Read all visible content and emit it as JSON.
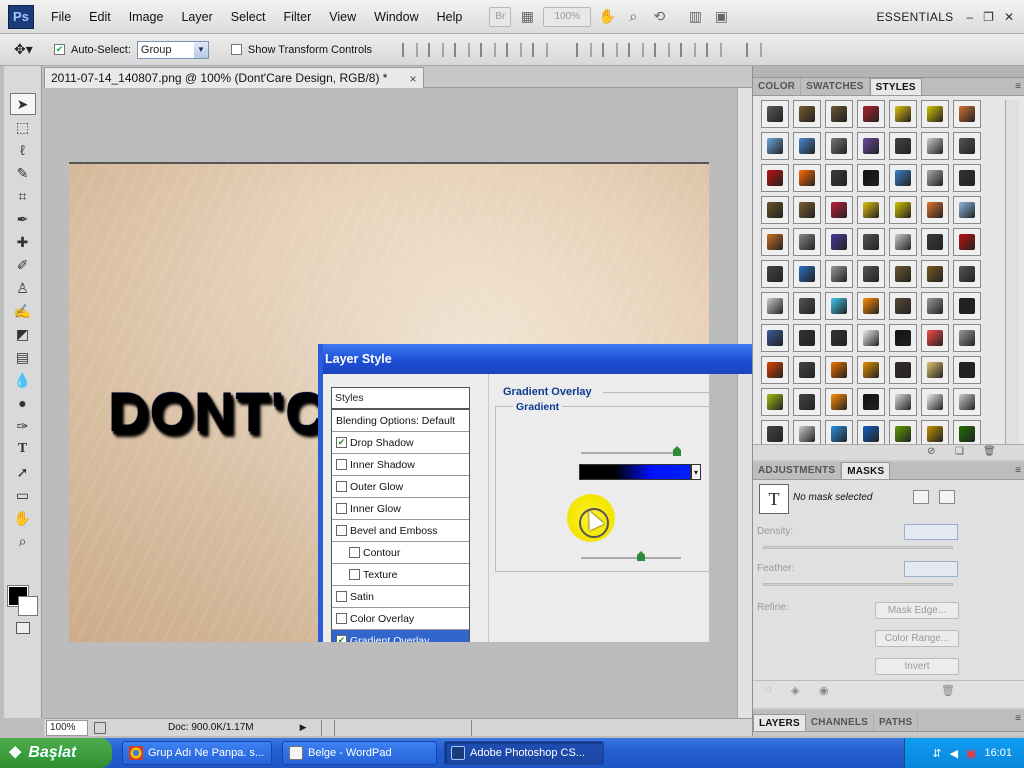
{
  "app": {
    "logo": "Ps",
    "workspace": "ESSENTIALS",
    "zoom_display": "100%"
  },
  "menu": [
    "File",
    "Edit",
    "Image",
    "Layer",
    "Select",
    "Filter",
    "View",
    "Window",
    "Help"
  ],
  "options_bar": {
    "auto_select_label": "Auto-Select:",
    "auto_select_checked": true,
    "group_value": "Group",
    "transform_label": "Show Transform Controls"
  },
  "document": {
    "tab_title": "2011-07-14_140807.png @ 100% (Dont'Care Design, RGB/8) *",
    "close_glyph": "×",
    "canvas_text": "DONT'C",
    "status_zoom": "100%",
    "status_info": "Doc: 900.0K/1.17M"
  },
  "dialog": {
    "title": "Layer Style",
    "styles_header": "Styles",
    "blending": "Blending Options: Default",
    "items": [
      {
        "label": "Drop Shadow",
        "checked": true,
        "sub": false
      },
      {
        "label": "Inner Shadow",
        "checked": false,
        "sub": false
      },
      {
        "label": "Outer Glow",
        "checked": false,
        "sub": false
      },
      {
        "label": "Inner Glow",
        "checked": false,
        "sub": false
      },
      {
        "label": "Bevel and Emboss",
        "checked": false,
        "sub": false
      },
      {
        "label": "Contour",
        "checked": false,
        "sub": true
      },
      {
        "label": "Texture",
        "checked": false,
        "sub": true
      },
      {
        "label": "Satin",
        "checked": false,
        "sub": false
      },
      {
        "label": "Color Overlay",
        "checked": false,
        "sub": false
      },
      {
        "label": "Gradient Overlay",
        "checked": true,
        "sub": false,
        "active": true
      }
    ],
    "section_title": "Gradient Overlay",
    "gradient_label": "Gradient",
    "dropdown_glyph": "▾"
  },
  "panels": {
    "top_tabs": [
      "COLOR",
      "SWATCHES",
      "STYLES"
    ],
    "active_top_tab": "STYLES",
    "mid_tabs": [
      "ADJUSTMENTS",
      "MASKS"
    ],
    "active_mid_tab": "MASKS",
    "mask_status": "No mask selected",
    "density_label": "Density:",
    "feather_label": "Feather:",
    "refine_label": "Refine:",
    "mask_edge_btn": "Mask Edge...",
    "color_range_btn": "Color Range...",
    "invert_btn": "Invert",
    "bottom_tabs": [
      "LAYERS",
      "CHANNELS",
      "PATHS"
    ],
    "active_bottom_tab": "LAYERS"
  },
  "style_swatch_colors": [
    "#5a5a5a",
    "#7a5a2a",
    "#6b5632",
    "#b0202a",
    "#e0c010",
    "#d4c400",
    "#d07030",
    "#6ea8e0",
    "#4a8ad0",
    "#777777",
    "#6a4aa0",
    "#444444",
    "#cccccc",
    "#555555",
    "#c01010",
    "#ff6a00",
    "#3a3a3a",
    "#101010",
    "#3a80c8",
    "#aaaaaa",
    "#333333",
    "#6a5428",
    "#7a6030",
    "#c02040",
    "#e0c010",
    "#d4c400",
    "#e07030",
    "#8ab8e0",
    "#c87020",
    "#888888",
    "#4a3a9a",
    "#555555",
    "#cccccc",
    "#3a3a3a",
    "#c01010",
    "#444444",
    "#2a70c0",
    "#999999",
    "#555555",
    "#6a5a30",
    "#7a5a20",
    "#555555",
    "#cccccc",
    "#555555",
    "#40c8f0",
    "#ff8c00",
    "#5a4a3a",
    "#999999",
    "#222222",
    "#3a5a9a",
    "#333333",
    "#333333",
    "#eeeeee",
    "#111111",
    "#ff4a4a",
    "#999999",
    "#e04000",
    "#444444",
    "#f07000",
    "#e09000",
    "#3a2a2a",
    "#e0c070",
    "#222222",
    "#a0c010",
    "#444444",
    "#ff8c00",
    "#111111",
    "#dddddd",
    "#eeeeee",
    "#cccccc",
    "#444444",
    "#cccccc",
    "#2a90e0",
    "#1060c0",
    "#60a000",
    "#c09000",
    "#207000"
  ],
  "taskbar": {
    "start_label": "Başlat",
    "tasks": [
      "Grup Adı Ne Panpa. s...",
      "Belge - WordPad",
      "Adobe Photoshop CS..."
    ],
    "active_task": 2,
    "time": "16:01"
  }
}
